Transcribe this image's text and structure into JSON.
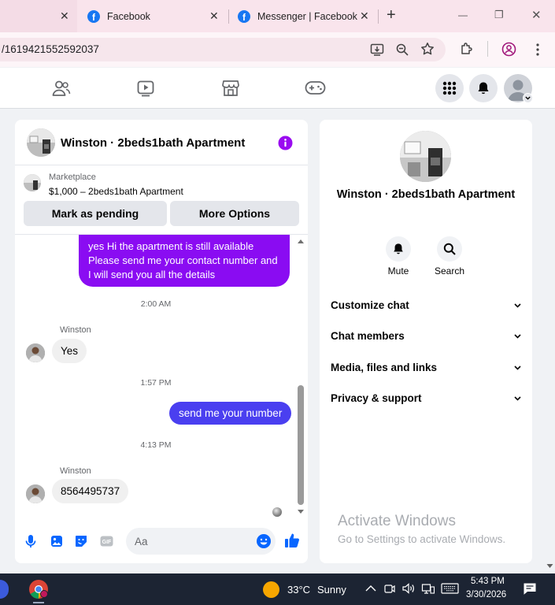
{
  "browser": {
    "tabs": [
      {
        "title": "",
        "close": "✕"
      },
      {
        "title": "Facebook",
        "close": "✕"
      },
      {
        "title": "Messenger | Facebook",
        "close": "✕"
      }
    ],
    "new_tab": "+",
    "window_controls": {
      "minimize": "—",
      "restore": "❐",
      "close": "✕"
    },
    "url": "/1619421552592037"
  },
  "conversation": {
    "title": "Winston · 2beds1bath Apartment",
    "marketplace_label": "Marketplace",
    "listing": "$1,000 – 2beds1bath Apartment",
    "mark_pending_label": "Mark as pending",
    "more_options_label": "More Options",
    "messages": {
      "out1": "yes Hi the apartment is still available Please send me your contact number and I will send you all the details",
      "ts1": "2:00 AM",
      "sender1": "Winston",
      "in1": "Yes",
      "ts2": "1:57 PM",
      "out2": "send me your number",
      "ts3": "4:13 PM",
      "sender2": "Winston",
      "in2": "8564495737"
    },
    "composer_placeholder": "Aa"
  },
  "info_panel": {
    "name": "Winston · 2beds1bath Apartment",
    "mute_label": "Mute",
    "search_label": "Search",
    "sections": [
      "Customize chat",
      "Chat members",
      "Media, files and links",
      "Privacy & support"
    ]
  },
  "watermark": {
    "title": "Activate Windows",
    "subtitle": "Go to Settings to activate Windows."
  },
  "taskbar": {
    "temperature": "33°C",
    "weather": "Sunny",
    "time": "5:43 PM",
    "date": "3/30/2026"
  },
  "colors": {
    "accent_purple": "#8a0cf2",
    "accent_blue": "#4a3ff0",
    "messenger_blue": "#0866ff"
  }
}
